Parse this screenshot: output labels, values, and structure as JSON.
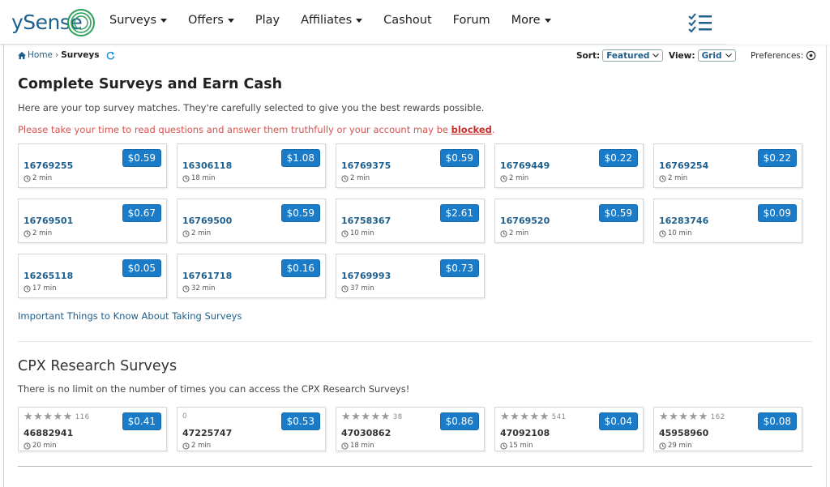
{
  "logo": {
    "text": "ySense"
  },
  "nav": [
    {
      "label": "Surveys",
      "dropdown": true
    },
    {
      "label": "Offers",
      "dropdown": true
    },
    {
      "label": "Play",
      "dropdown": false
    },
    {
      "label": "Affiliates",
      "dropdown": true
    },
    {
      "label": "Cashout",
      "dropdown": false
    },
    {
      "label": "Forum",
      "dropdown": false
    },
    {
      "label": "More",
      "dropdown": true
    }
  ],
  "breadcrumb": {
    "home": "Home",
    "sep": "›",
    "current": "Surveys"
  },
  "controls": {
    "sort_label": "Sort:",
    "sort_value": "Featured",
    "view_label": "View:",
    "view_value": "Grid",
    "pref_label": "Preferences:"
  },
  "main": {
    "title": "Complete Surveys and Earn Cash",
    "subtitle": "Here are your top survey matches. They're carefully selected to give you the best rewards possible.",
    "warning_prefix": "Please take your time to read questions and answer them truthfully or your account may be ",
    "warning_strong": "blocked",
    "warning_suffix": ".",
    "important_link": "Important Things to Know About Taking Surveys"
  },
  "surveys": [
    {
      "id": "16769255",
      "price": "$0.59",
      "duration": "2 min"
    },
    {
      "id": "16306118",
      "price": "$1.08",
      "duration": "18 min"
    },
    {
      "id": "16769375",
      "price": "$0.59",
      "duration": "2 min"
    },
    {
      "id": "16769449",
      "price": "$0.22",
      "duration": "2 min"
    },
    {
      "id": "16769254",
      "price": "$0.22",
      "duration": "2 min"
    },
    {
      "id": "16769501",
      "price": "$0.67",
      "duration": "2 min"
    },
    {
      "id": "16769500",
      "price": "$0.59",
      "duration": "2 min"
    },
    {
      "id": "16758367",
      "price": "$2.61",
      "duration": "10 min"
    },
    {
      "id": "16769520",
      "price": "$0.59",
      "duration": "2 min"
    },
    {
      "id": "16283746",
      "price": "$0.09",
      "duration": "10 min"
    },
    {
      "id": "16265118",
      "price": "$0.05",
      "duration": "17 min"
    },
    {
      "id": "16761718",
      "price": "$0.16",
      "duration": "32 min"
    },
    {
      "id": "16769993",
      "price": "$0.73",
      "duration": "37 min"
    }
  ],
  "cpx": {
    "title": "CPX Research Surveys",
    "subtitle": "There is no limit on the number of times you can access the CPX Research Surveys!",
    "surveys": [
      {
        "id": "46882941",
        "price": "$0.41",
        "duration": "20 min",
        "stars": "★★★★★",
        "ratings": "116"
      },
      {
        "id": "47225747",
        "price": "$0.53",
        "duration": "2 min",
        "stars": "",
        "ratings": "0"
      },
      {
        "id": "47030862",
        "price": "$0.86",
        "duration": "18 min",
        "stars": "★★★★★",
        "ratings": "38"
      },
      {
        "id": "47092108",
        "price": "$0.04",
        "duration": "15 min",
        "stars": "★★★★★",
        "ratings": "541"
      },
      {
        "id": "45958960",
        "price": "$0.08",
        "duration": "29 min",
        "stars": "★★★★★",
        "ratings": "162"
      }
    ]
  },
  "colors": {
    "brand": "#1f5f8b",
    "price": "#1a7bc8",
    "warning": "#d9534f"
  }
}
